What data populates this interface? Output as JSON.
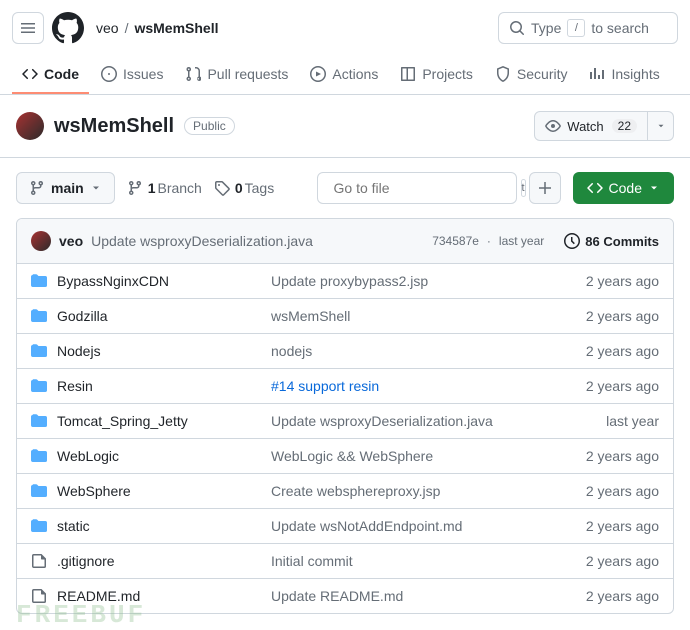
{
  "header": {
    "owner": "veo",
    "sep": "/",
    "repo": "wsMemShell",
    "search_prefix": "Type",
    "search_suffix": "to search",
    "slash": "/"
  },
  "tabs": [
    {
      "key": "code",
      "label": "Code",
      "active": true
    },
    {
      "key": "issues",
      "label": "Issues",
      "active": false
    },
    {
      "key": "pulls",
      "label": "Pull requests",
      "active": false
    },
    {
      "key": "actions",
      "label": "Actions",
      "active": false
    },
    {
      "key": "projects",
      "label": "Projects",
      "active": false
    },
    {
      "key": "security",
      "label": "Security",
      "active": false
    },
    {
      "key": "insights",
      "label": "Insights",
      "active": false
    }
  ],
  "repo_header": {
    "name": "wsMemShell",
    "visibility": "Public",
    "watch_label": "Watch",
    "watch_count": "22"
  },
  "toolbar": {
    "branch": "main",
    "branches_count": "1",
    "branches_label": "Branch",
    "tags_count": "0",
    "tags_label": "Tags",
    "file_search_placeholder": "Go to file",
    "kbd": "t",
    "code_label": "Code"
  },
  "last_commit": {
    "author": "veo",
    "message": "Update wsproxyDeserialization.java",
    "sha": "734587e",
    "sep": "·",
    "time": "last year",
    "commits_count": "86",
    "commits_label": "Commits"
  },
  "files": [
    {
      "type": "dir",
      "name": "BypassNginxCDN",
      "msg": "Update proxybypass2.jsp",
      "time": "2 years ago",
      "link": false
    },
    {
      "type": "dir",
      "name": "Godzilla",
      "msg": "wsMemShell",
      "time": "2 years ago",
      "link": false
    },
    {
      "type": "dir",
      "name": "Nodejs",
      "msg": "nodejs",
      "time": "2 years ago",
      "link": false
    },
    {
      "type": "dir",
      "name": "Resin",
      "msg": "#14 support resin",
      "time": "2 years ago",
      "link": true
    },
    {
      "type": "dir",
      "name": "Tomcat_Spring_Jetty",
      "msg": "Update wsproxyDeserialization.java",
      "time": "last year",
      "link": false
    },
    {
      "type": "dir",
      "name": "WebLogic",
      "msg": "WebLogic && WebSphere",
      "time": "2 years ago",
      "link": false
    },
    {
      "type": "dir",
      "name": "WebSphere",
      "msg": "Create websphereproxy.jsp",
      "time": "2 years ago",
      "link": false
    },
    {
      "type": "dir",
      "name": "static",
      "msg": "Update wsNotAddEndpoint.md",
      "time": "2 years ago",
      "link": false
    },
    {
      "type": "file",
      "name": ".gitignore",
      "msg": "Initial commit",
      "time": "2 years ago",
      "link": false
    },
    {
      "type": "file",
      "name": "README.md",
      "msg": "Update README.md",
      "time": "2 years ago",
      "link": false
    }
  ],
  "watermark": "FREEBUF"
}
